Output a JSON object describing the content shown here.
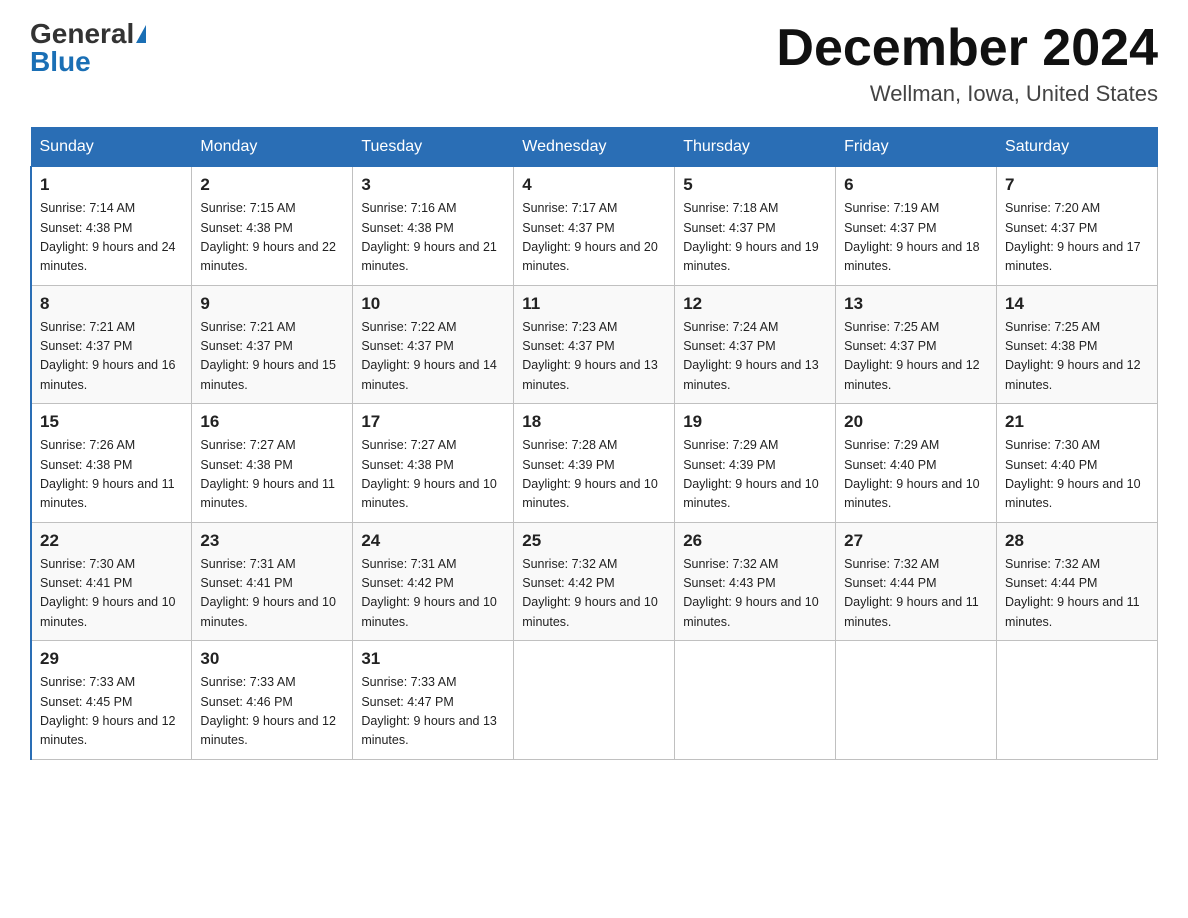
{
  "header": {
    "logo_general": "General",
    "logo_blue": "Blue",
    "month_title": "December 2024",
    "location": "Wellman, Iowa, United States"
  },
  "weekdays": [
    "Sunday",
    "Monday",
    "Tuesday",
    "Wednesday",
    "Thursday",
    "Friday",
    "Saturday"
  ],
  "weeks": [
    [
      {
        "day": "1",
        "sunrise": "Sunrise: 7:14 AM",
        "sunset": "Sunset: 4:38 PM",
        "daylight": "Daylight: 9 hours and 24 minutes."
      },
      {
        "day": "2",
        "sunrise": "Sunrise: 7:15 AM",
        "sunset": "Sunset: 4:38 PM",
        "daylight": "Daylight: 9 hours and 22 minutes."
      },
      {
        "day": "3",
        "sunrise": "Sunrise: 7:16 AM",
        "sunset": "Sunset: 4:38 PM",
        "daylight": "Daylight: 9 hours and 21 minutes."
      },
      {
        "day": "4",
        "sunrise": "Sunrise: 7:17 AM",
        "sunset": "Sunset: 4:37 PM",
        "daylight": "Daylight: 9 hours and 20 minutes."
      },
      {
        "day": "5",
        "sunrise": "Sunrise: 7:18 AM",
        "sunset": "Sunset: 4:37 PM",
        "daylight": "Daylight: 9 hours and 19 minutes."
      },
      {
        "day": "6",
        "sunrise": "Sunrise: 7:19 AM",
        "sunset": "Sunset: 4:37 PM",
        "daylight": "Daylight: 9 hours and 18 minutes."
      },
      {
        "day": "7",
        "sunrise": "Sunrise: 7:20 AM",
        "sunset": "Sunset: 4:37 PM",
        "daylight": "Daylight: 9 hours and 17 minutes."
      }
    ],
    [
      {
        "day": "8",
        "sunrise": "Sunrise: 7:21 AM",
        "sunset": "Sunset: 4:37 PM",
        "daylight": "Daylight: 9 hours and 16 minutes."
      },
      {
        "day": "9",
        "sunrise": "Sunrise: 7:21 AM",
        "sunset": "Sunset: 4:37 PM",
        "daylight": "Daylight: 9 hours and 15 minutes."
      },
      {
        "day": "10",
        "sunrise": "Sunrise: 7:22 AM",
        "sunset": "Sunset: 4:37 PM",
        "daylight": "Daylight: 9 hours and 14 minutes."
      },
      {
        "day": "11",
        "sunrise": "Sunrise: 7:23 AM",
        "sunset": "Sunset: 4:37 PM",
        "daylight": "Daylight: 9 hours and 13 minutes."
      },
      {
        "day": "12",
        "sunrise": "Sunrise: 7:24 AM",
        "sunset": "Sunset: 4:37 PM",
        "daylight": "Daylight: 9 hours and 13 minutes."
      },
      {
        "day": "13",
        "sunrise": "Sunrise: 7:25 AM",
        "sunset": "Sunset: 4:37 PM",
        "daylight": "Daylight: 9 hours and 12 minutes."
      },
      {
        "day": "14",
        "sunrise": "Sunrise: 7:25 AM",
        "sunset": "Sunset: 4:38 PM",
        "daylight": "Daylight: 9 hours and 12 minutes."
      }
    ],
    [
      {
        "day": "15",
        "sunrise": "Sunrise: 7:26 AM",
        "sunset": "Sunset: 4:38 PM",
        "daylight": "Daylight: 9 hours and 11 minutes."
      },
      {
        "day": "16",
        "sunrise": "Sunrise: 7:27 AM",
        "sunset": "Sunset: 4:38 PM",
        "daylight": "Daylight: 9 hours and 11 minutes."
      },
      {
        "day": "17",
        "sunrise": "Sunrise: 7:27 AM",
        "sunset": "Sunset: 4:38 PM",
        "daylight": "Daylight: 9 hours and 10 minutes."
      },
      {
        "day": "18",
        "sunrise": "Sunrise: 7:28 AM",
        "sunset": "Sunset: 4:39 PM",
        "daylight": "Daylight: 9 hours and 10 minutes."
      },
      {
        "day": "19",
        "sunrise": "Sunrise: 7:29 AM",
        "sunset": "Sunset: 4:39 PM",
        "daylight": "Daylight: 9 hours and 10 minutes."
      },
      {
        "day": "20",
        "sunrise": "Sunrise: 7:29 AM",
        "sunset": "Sunset: 4:40 PM",
        "daylight": "Daylight: 9 hours and 10 minutes."
      },
      {
        "day": "21",
        "sunrise": "Sunrise: 7:30 AM",
        "sunset": "Sunset: 4:40 PM",
        "daylight": "Daylight: 9 hours and 10 minutes."
      }
    ],
    [
      {
        "day": "22",
        "sunrise": "Sunrise: 7:30 AM",
        "sunset": "Sunset: 4:41 PM",
        "daylight": "Daylight: 9 hours and 10 minutes."
      },
      {
        "day": "23",
        "sunrise": "Sunrise: 7:31 AM",
        "sunset": "Sunset: 4:41 PM",
        "daylight": "Daylight: 9 hours and 10 minutes."
      },
      {
        "day": "24",
        "sunrise": "Sunrise: 7:31 AM",
        "sunset": "Sunset: 4:42 PM",
        "daylight": "Daylight: 9 hours and 10 minutes."
      },
      {
        "day": "25",
        "sunrise": "Sunrise: 7:32 AM",
        "sunset": "Sunset: 4:42 PM",
        "daylight": "Daylight: 9 hours and 10 minutes."
      },
      {
        "day": "26",
        "sunrise": "Sunrise: 7:32 AM",
        "sunset": "Sunset: 4:43 PM",
        "daylight": "Daylight: 9 hours and 10 minutes."
      },
      {
        "day": "27",
        "sunrise": "Sunrise: 7:32 AM",
        "sunset": "Sunset: 4:44 PM",
        "daylight": "Daylight: 9 hours and 11 minutes."
      },
      {
        "day": "28",
        "sunrise": "Sunrise: 7:32 AM",
        "sunset": "Sunset: 4:44 PM",
        "daylight": "Daylight: 9 hours and 11 minutes."
      }
    ],
    [
      {
        "day": "29",
        "sunrise": "Sunrise: 7:33 AM",
        "sunset": "Sunset: 4:45 PM",
        "daylight": "Daylight: 9 hours and 12 minutes."
      },
      {
        "day": "30",
        "sunrise": "Sunrise: 7:33 AM",
        "sunset": "Sunset: 4:46 PM",
        "daylight": "Daylight: 9 hours and 12 minutes."
      },
      {
        "day": "31",
        "sunrise": "Sunrise: 7:33 AM",
        "sunset": "Sunset: 4:47 PM",
        "daylight": "Daylight: 9 hours and 13 minutes."
      },
      null,
      null,
      null,
      null
    ]
  ]
}
